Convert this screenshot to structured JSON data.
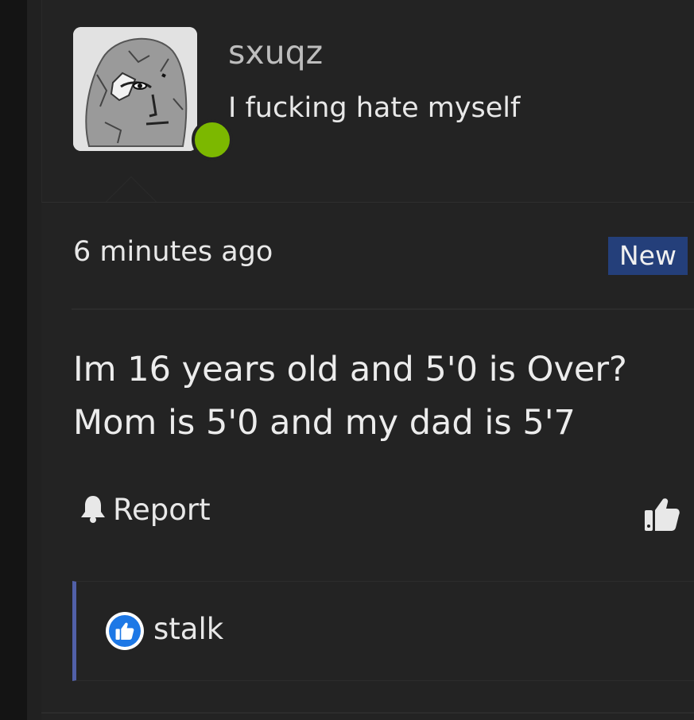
{
  "post": {
    "author": {
      "username": "sxuqz",
      "tagline": "I fucking hate myself",
      "online_status_color": "#7cb800"
    },
    "timestamp": "6 minutes ago",
    "badge": "New",
    "body_lines": [
      "Im 16 years old and 5'0 is Over?",
      "Mom is 5'0 and my dad is 5'7"
    ],
    "actions": {
      "report_label": "Report",
      "report_icon": "bell-icon",
      "like_icon": "thumbs-up-icon"
    }
  },
  "reply": {
    "name": "stalk",
    "icon": "thumbs-up-icon",
    "accent_color": "#5160a8"
  },
  "colors": {
    "background": "#212121",
    "badge_bg": "#243f7a",
    "text": "#e8e8e8"
  }
}
